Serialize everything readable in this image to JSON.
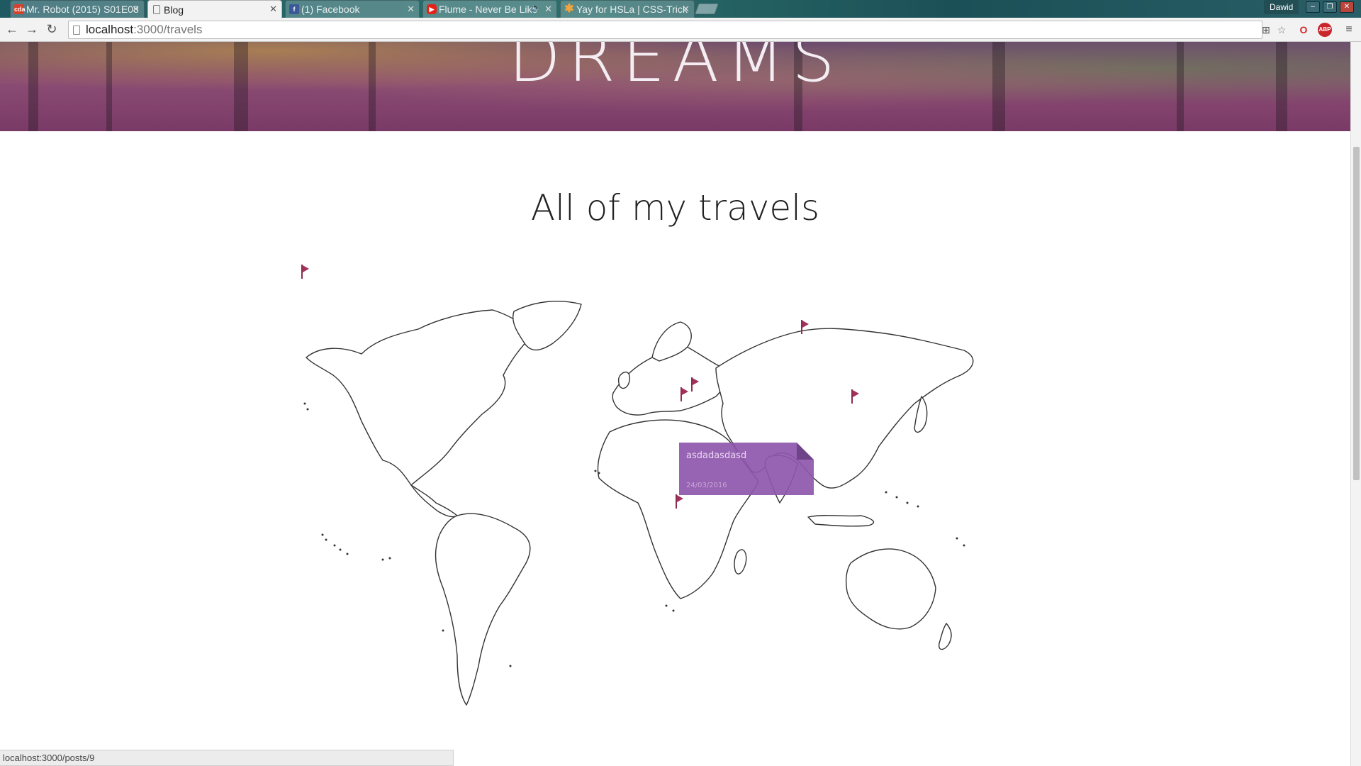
{
  "browser": {
    "tabs": [
      {
        "title": "Mr. Robot (2015) S01E08",
        "favicon": "cda-icon",
        "active": false
      },
      {
        "title": "Blog",
        "favicon": "page-icon",
        "active": true
      },
      {
        "title": "(1) Facebook",
        "favicon": "facebook-icon",
        "active": false
      },
      {
        "title": "Flume - Never Be Like",
        "favicon": "youtube-icon",
        "active": false,
        "audio": true
      },
      {
        "title": "Yay for HSLa | CSS-Trick",
        "favicon": "csstricks-icon",
        "active": false
      }
    ],
    "profile_name": "Dawid",
    "address": {
      "host": "localhost",
      "path": ":3000/travels"
    },
    "status_url": "localhost:3000/posts/9"
  },
  "page": {
    "hero_title": "DREAMS",
    "heading": "All of my travels",
    "popup": {
      "title": "asdadasdasd",
      "date": "24/03/2016"
    },
    "flag_count": 6
  },
  "colors": {
    "flag": "#a3315c",
    "popup": "#8e56ac",
    "hero_tint": "#7a3a67"
  }
}
